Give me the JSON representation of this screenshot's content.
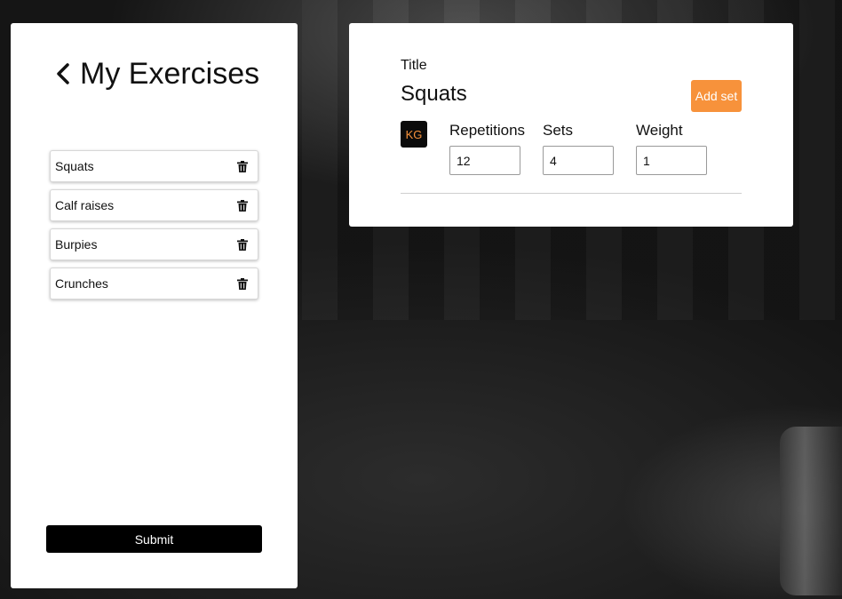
{
  "sidebar": {
    "title": "My Exercises",
    "back_icon": "chevron-left-icon",
    "items": [
      {
        "label": "Squats",
        "icon": "trash-icon"
      },
      {
        "label": "Calf raises",
        "icon": "trash-icon"
      },
      {
        "label": "Burpies",
        "icon": "trash-icon"
      },
      {
        "label": "Crunches",
        "icon": "trash-icon"
      }
    ],
    "submit_label": "Submit"
  },
  "detail": {
    "title_label": "Title",
    "exercise_title": "Squats",
    "add_set_label": "Add set",
    "unit_badge": "KG",
    "fields": {
      "repetitions": {
        "label": "Repetitions",
        "value": "12"
      },
      "sets": {
        "label": "Sets",
        "value": "4"
      },
      "weight": {
        "label": "Weight",
        "value": "1"
      }
    }
  },
  "colors": {
    "accent": "#f7923b",
    "submit_bg": "#000000",
    "card_bg": "#ffffff"
  }
}
